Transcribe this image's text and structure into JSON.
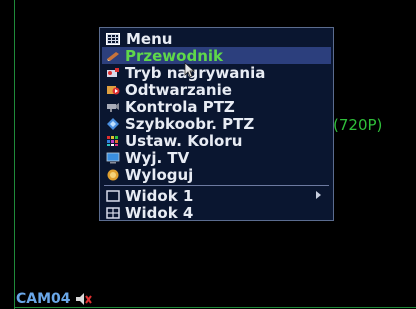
{
  "menu": {
    "title": "Menu",
    "items": [
      {
        "label": "Przewodnik",
        "icon": "guide-icon",
        "selected": true
      },
      {
        "label": "Tryb nagrywania",
        "icon": "record-mode-icon"
      },
      {
        "label": "Odtwarzanie",
        "icon": "playback-icon"
      },
      {
        "label": "Kontrola PTZ",
        "icon": "ptz-icon"
      },
      {
        "label": "Szybkoobr. PTZ",
        "icon": "ptz-preset-icon"
      },
      {
        "label": "Ustaw. Koloru",
        "icon": "color-icon"
      },
      {
        "label": "Wyj. TV",
        "icon": "tv-icon"
      },
      {
        "label": "Wyloguj",
        "icon": "logout-icon"
      }
    ],
    "view_items": [
      {
        "label": "Widok 1",
        "icon": "view1-icon",
        "submenu": true
      },
      {
        "label": "Widok 4",
        "icon": "view4-icon"
      }
    ]
  },
  "resolution_label": "(720P)",
  "camera_label": "CAM04",
  "colors": {
    "accent_selected_text": "#5fd84a",
    "selected_bg": "#2c3f7d",
    "res_label": "#2fbf3a",
    "cam_label": "#6aa7e8"
  }
}
